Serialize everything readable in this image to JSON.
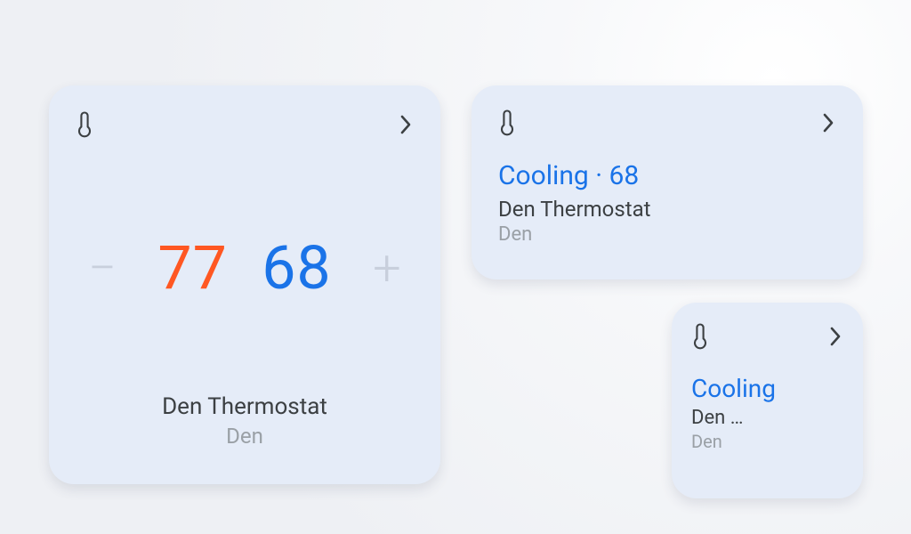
{
  "thermostat_large": {
    "heat_setpoint": "77",
    "cool_setpoint": "68",
    "device_name": "Den Thermostat",
    "room": "Den"
  },
  "thermostat_medium": {
    "status_line": "Cooling · 68",
    "device_name": "Den Thermostat",
    "room": "Den"
  },
  "thermostat_small": {
    "status_line": "Cooling",
    "device_name": "Den …",
    "room": "Den"
  }
}
